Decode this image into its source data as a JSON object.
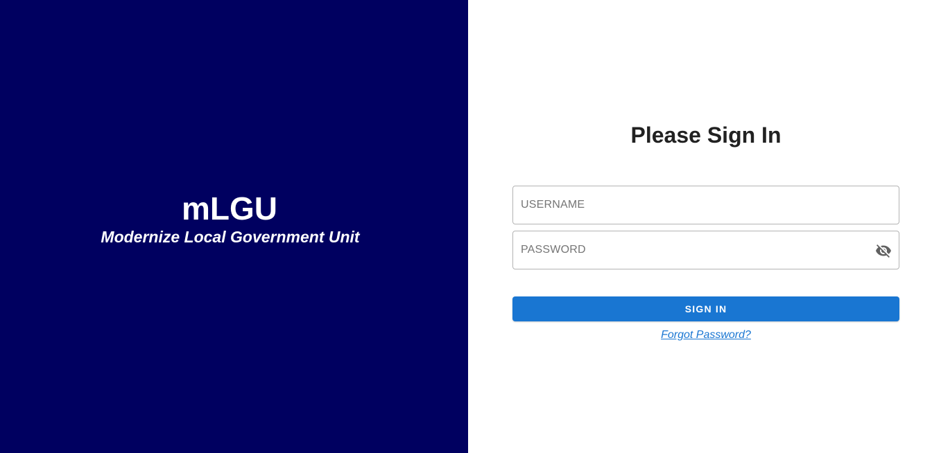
{
  "brand": {
    "title": "mLGU",
    "subtitle": "Modernize Local Government Unit",
    "background_color": "#000060"
  },
  "form": {
    "title": "Please Sign In",
    "username": {
      "placeholder": "USERNAME",
      "value": ""
    },
    "password": {
      "placeholder": "PASSWORD",
      "value": "",
      "toggle_icon": "visibility-off-icon"
    },
    "signin_label": "SIGN IN",
    "forgot_label": "Forgot Password?",
    "accent_color": "#1976d2"
  }
}
